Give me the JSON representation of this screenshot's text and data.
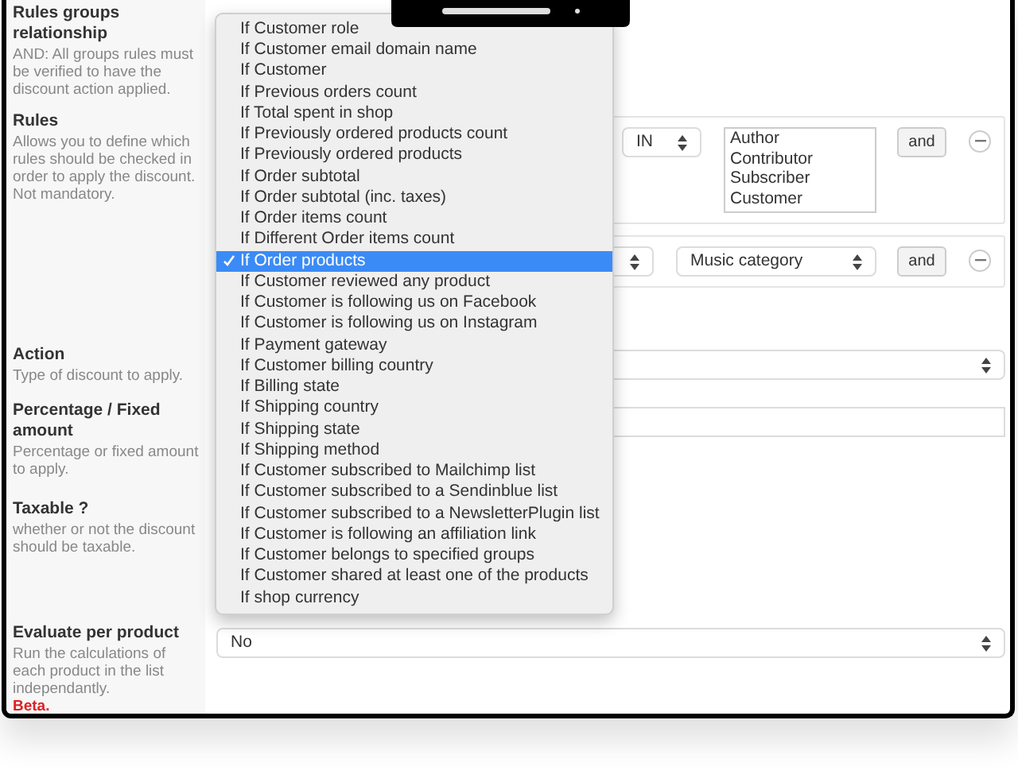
{
  "fields": [
    {
      "kind": "radios",
      "label": "Rules groups relationship",
      "description": "AND: All groups rules must be verified to have the discount action applied."
    },
    {
      "kind": "rules",
      "label": "Rules",
      "description": "Allows you to define which rules should be checked in order to apply the discount. Not mandatory.",
      "rules": [
        {
          "kind": "listbox",
          "operator": "IN",
          "values": [
            "Author",
            "Contributor",
            "Subscriber",
            "Customer"
          ],
          "button": "and"
        },
        {
          "kind": "select",
          "value": "Music category",
          "button": "and"
        }
      ]
    },
    {
      "kind": "select",
      "label": "Action",
      "description": "Type of discount to apply."
    },
    {
      "kind": "input",
      "label": "Percentage / Fixed amount",
      "description": "Percentage or fixed amount to apply."
    },
    {
      "kind": "radios",
      "label": "Taxable ?",
      "description": "whether or not the discount should be taxable."
    },
    {
      "kind": "select",
      "label": "Evaluate per product",
      "description": "Run the calculations of each product in the list independantly.",
      "value": "No",
      "note": "Beta."
    }
  ],
  "condition_dropdown": {
    "options": [
      {
        "label": "If Customer role",
        "selected": false
      },
      {
        "label": "If Customer email domain name",
        "selected": false
      },
      {
        "label": "If Customer",
        "selected": false
      },
      {
        "label": "If Previous orders count",
        "selected": false
      },
      {
        "label": "If Total spent in shop",
        "selected": false
      },
      {
        "label": "If Previously ordered products count",
        "selected": false
      },
      {
        "label": "If Previously ordered products",
        "selected": false
      },
      {
        "label": "If Order subtotal",
        "selected": false
      },
      {
        "label": "If Order subtotal (inc. taxes)",
        "selected": false
      },
      {
        "label": "If Order items count",
        "selected": false
      },
      {
        "label": "If Different Order items count",
        "selected": false
      },
      {
        "label": "If Order products",
        "selected": true
      },
      {
        "label": "If Customer reviewed any product",
        "selected": false
      },
      {
        "label": "If Customer is following us on Facebook",
        "selected": false
      },
      {
        "label": "If Customer is following us on Instagram",
        "selected": false
      },
      {
        "label": "If Payment gateway",
        "selected": false
      },
      {
        "label": "If Customer billing country",
        "selected": false
      },
      {
        "label": "If Billing state",
        "selected": false
      },
      {
        "label": "If Shipping country",
        "selected": false
      },
      {
        "label": "If Shipping state",
        "selected": false
      },
      {
        "label": "If Shipping method",
        "selected": false
      },
      {
        "label": "If Customer subscribed to Mailchimp list",
        "selected": false
      },
      {
        "label": "If Customer subscribed to a Sendinblue list",
        "selected": false
      },
      {
        "label": "If Customer subscribed to a NewsletterPlugin list",
        "selected": false
      },
      {
        "label": "If Customer is following an affiliation link",
        "selected": false
      },
      {
        "label": "If Customer belongs to specified groups",
        "selected": false
      },
      {
        "label": "If Customer shared at least one of the products",
        "selected": false
      },
      {
        "label": "If shop currency",
        "selected": false
      }
    ]
  }
}
